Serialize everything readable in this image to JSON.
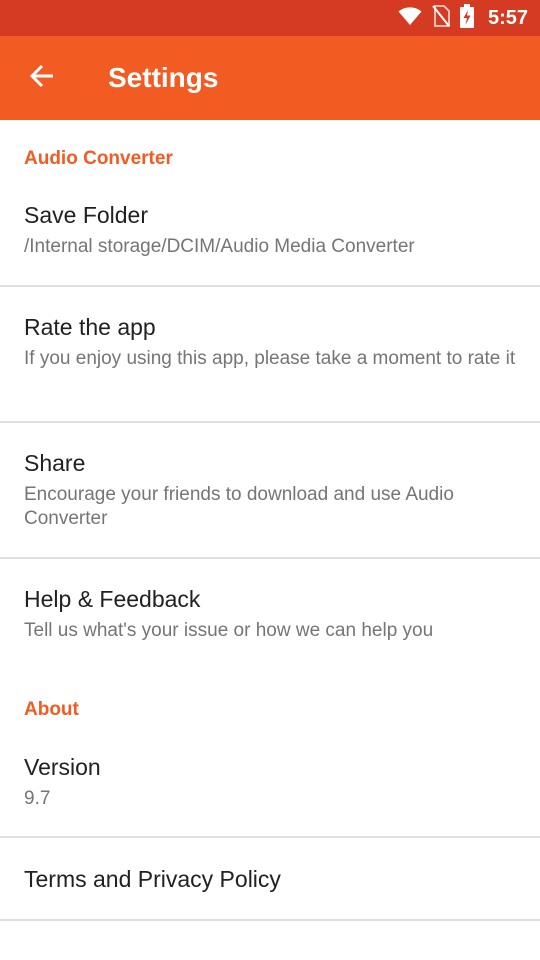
{
  "status_bar": {
    "time": "5:57",
    "icons": [
      "wifi-icon",
      "no-sim-icon",
      "battery-charging-icon"
    ],
    "color": "#d43b22"
  },
  "toolbar": {
    "title": "Settings",
    "back_icon": "arrow-left-icon",
    "color": "#f25b22"
  },
  "sections": {
    "audio_converter": {
      "label": "Audio Converter",
      "items": {
        "save_folder": {
          "title": "Save Folder",
          "summary": "/Internal storage/DCIM/Audio Media Converter"
        },
        "rate": {
          "title": "Rate the app",
          "summary": "If you enjoy using this app, please take a moment to rate it"
        },
        "share": {
          "title": "Share",
          "summary": "Encourage your friends to download and use Audio Converter"
        },
        "help": {
          "title": "Help & Feedback",
          "summary": "Tell us what's your issue or how we can help you"
        }
      }
    },
    "about": {
      "label": "About",
      "items": {
        "version": {
          "title": "Version",
          "summary": "9.7"
        },
        "terms": {
          "title": "Terms and Privacy Policy"
        }
      }
    }
  },
  "accent_color": "#f25b22"
}
